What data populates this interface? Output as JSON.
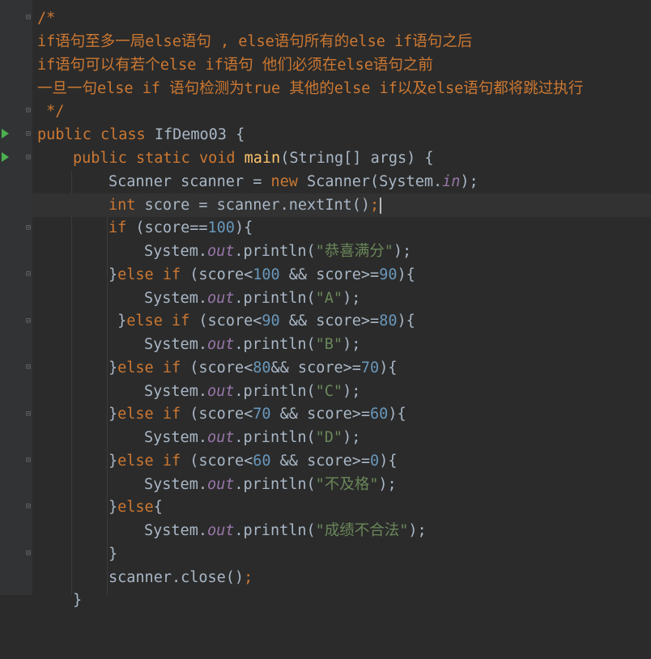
{
  "editor": {
    "comment_open": "/*",
    "comment_line1": "if语句至多一局else语句 , else语句所有的else if语句之后",
    "comment_line2": "if语句可以有若个else if语句 他们必须在else语句之前",
    "comment_line3": "一旦一句else if 语句检测为true 其他的else if以及else语句都将跳过执行",
    "comment_close": " */",
    "kw_public": "public",
    "kw_class": "class",
    "class_name": "IfDemo03",
    "kw_static": "static",
    "kw_void": "void",
    "method_main": "main",
    "params": "(String[] args) {",
    "brace_open": "{",
    "scanner_decl": "Scanner scanner = ",
    "kw_new": "new",
    "scanner_ctor": " Scanner(System.",
    "field_in": "in",
    "semicolon_close": ");",
    "kw_int": "int",
    "score_decl": " score = scanner.nextInt()",
    "semicolon": ";",
    "kw_if": "if",
    "kw_else": "else",
    "system": "System.",
    "field_out": "out",
    "println_open": ".println(",
    "cond_100": "(score==",
    "num_100": "100",
    "cond_lt": "(score<",
    "cond_and_ge": " && score>=",
    "cond_and_ge_tight": "&& score>=",
    "num_90": "90",
    "num_80": "80",
    "num_70": "70",
    "num_60": "60",
    "num_0": "0",
    "paren_brace": "){",
    "str_full": "\"恭喜满分\"",
    "str_a": "\"A\"",
    "str_b": "\"B\"",
    "str_c": "\"C\"",
    "str_d": "\"D\"",
    "str_fail": "\"不及格\"",
    "str_invalid": "\"成绩不合法\"",
    "close_brace": "}",
    "close_brace_spaced": " }",
    "scanner_close": "scanner.close()",
    "last_brace": "}"
  }
}
